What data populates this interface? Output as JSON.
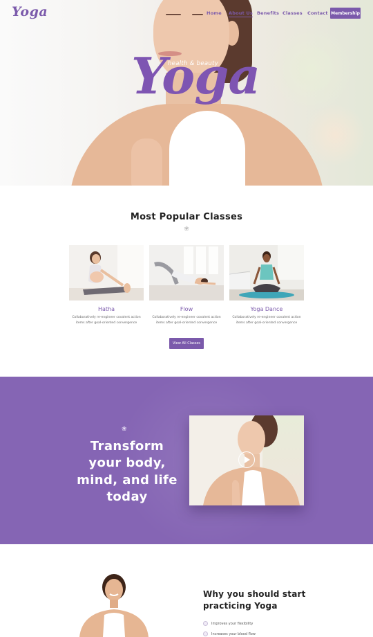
{
  "brand": {
    "logo": "Yoga",
    "accent": "#7b5aab"
  },
  "nav": {
    "items": [
      {
        "label": "Home",
        "active": false
      },
      {
        "label": "About Us",
        "active": true
      },
      {
        "label": "Benefits",
        "active": false
      },
      {
        "label": "Classes",
        "active": false
      },
      {
        "label": "Contact",
        "active": false
      }
    ],
    "membership_label": "Membership"
  },
  "hero": {
    "subtitle": "health & beauty",
    "title": "Yoga"
  },
  "popular": {
    "title": "Most Popular Classes",
    "classes": [
      {
        "name": "Hatha",
        "desc": "Collaboratively re-engineer covalent action items after goal-oriented convergence"
      },
      {
        "name": "Flow",
        "desc": "Collaboratively re-engineer covalent action items after goal-oriented convergence"
      },
      {
        "name": "Yoga Dance",
        "desc": "Collaboratively re-engineer covalent action items after goal-oriented convergence"
      }
    ],
    "view_all_label": "View All Classes"
  },
  "transform": {
    "title": "Transform your body, mind, and life today",
    "play_icon": "play-icon"
  },
  "why": {
    "title": "Why you should start practicing Yoga",
    "items": [
      "Improves your flexibility",
      "Increases your blood flow"
    ]
  }
}
